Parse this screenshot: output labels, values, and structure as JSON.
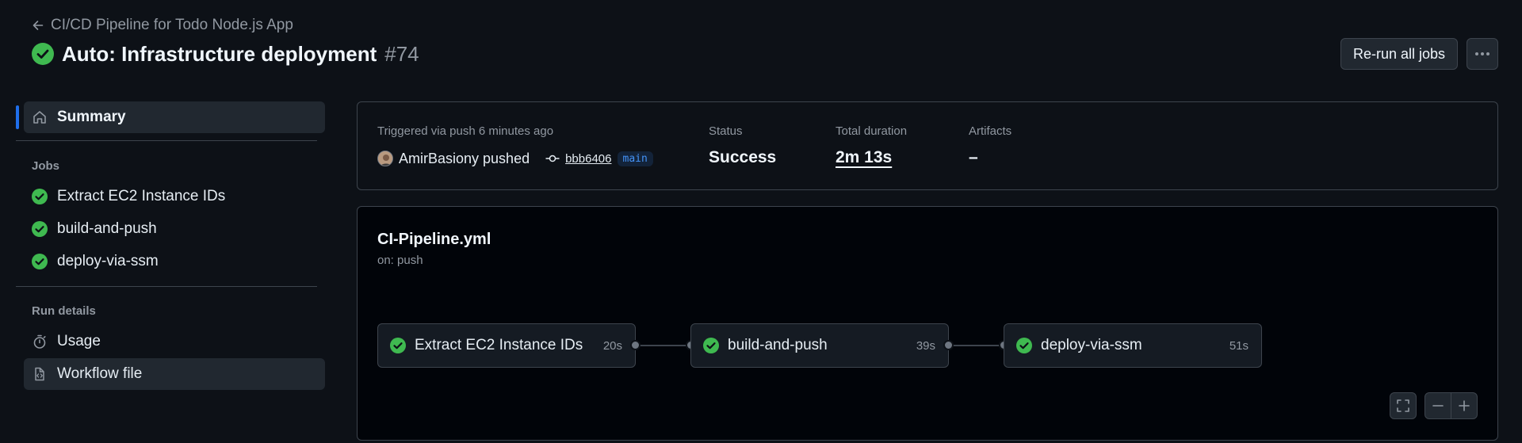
{
  "header": {
    "back_label": "CI/CD Pipeline for Todo Node.js App",
    "title": "Auto: Infrastructure deployment",
    "run_number": "#74",
    "rerun_label": "Re-run all jobs"
  },
  "sidebar": {
    "summary_label": "Summary",
    "jobs_heading": "Jobs",
    "jobs": [
      {
        "label": "Extract EC2 Instance IDs"
      },
      {
        "label": "build-and-push"
      },
      {
        "label": "deploy-via-ssm"
      }
    ],
    "run_details_heading": "Run details",
    "usage_label": "Usage",
    "workflow_file_label": "Workflow file"
  },
  "summary": {
    "trigger_label": "Triggered via push 6 minutes ago",
    "actor": "AmirBasiony pushed",
    "commit": "bbb6406",
    "branch": "main",
    "status_label": "Status",
    "status_value": "Success",
    "duration_label": "Total duration",
    "duration_value": "2m 13s",
    "artifacts_label": "Artifacts",
    "artifacts_value": "–"
  },
  "workflow": {
    "file": "CI-Pipeline.yml",
    "trigger": "on: push",
    "jobs": [
      {
        "name": "Extract EC2 Instance IDs",
        "duration": "20s"
      },
      {
        "name": "build-and-push",
        "duration": "39s"
      },
      {
        "name": "deploy-via-ssm",
        "duration": "51s"
      }
    ]
  },
  "colors": {
    "success": "#3fb950",
    "accent": "#1f6feb",
    "background": "#0d1117"
  }
}
